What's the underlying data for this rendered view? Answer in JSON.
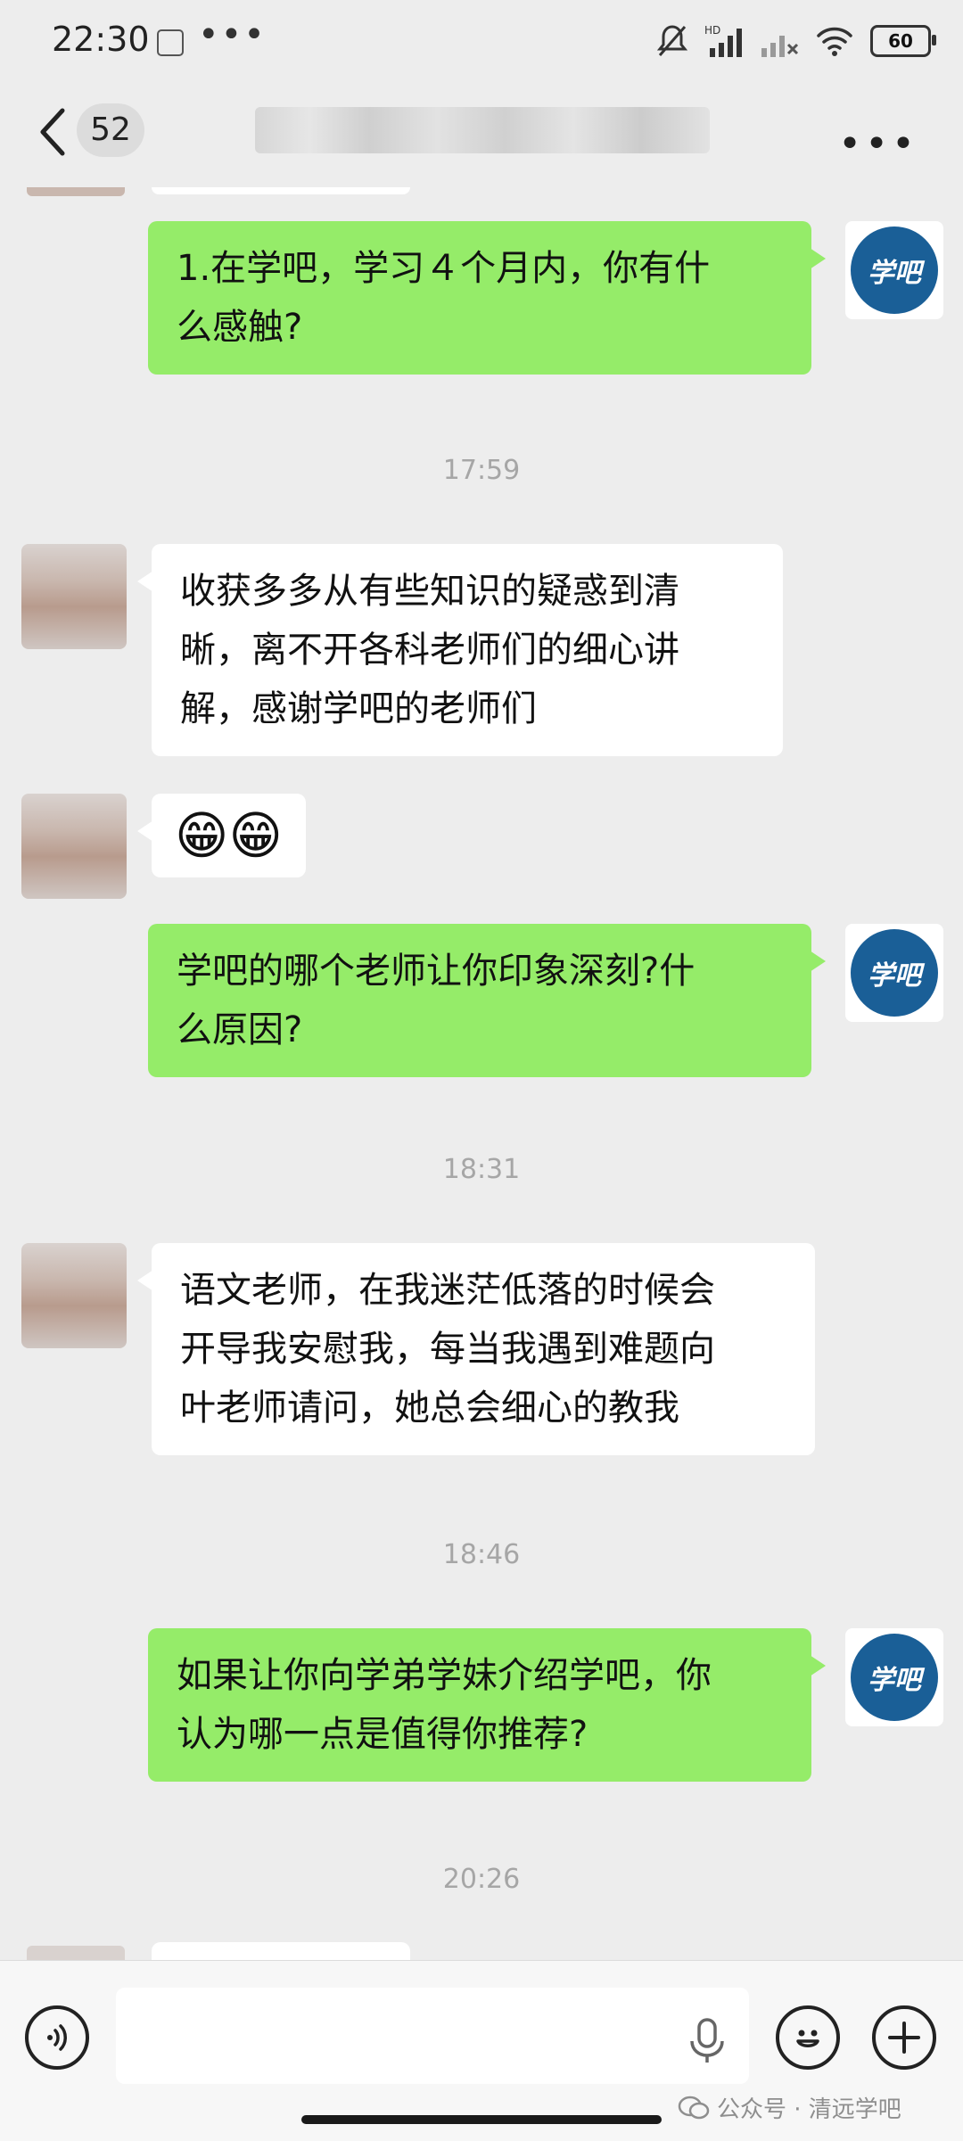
{
  "status_bar": {
    "time": "22:30",
    "dots": "•••",
    "hd": "HD",
    "battery": "60",
    "icons": [
      "notification-icon",
      "mute-icon",
      "signal-icon",
      "signal-x-icon",
      "wifi-icon",
      "battery-icon"
    ]
  },
  "nav": {
    "back_icon": "chevron-left-icon",
    "unread_count": "52",
    "title": "",
    "more_label": "•••"
  },
  "messages": [
    {
      "side": "me",
      "text": "1.在学吧，学习4个月内，你有什么感触?",
      "lines": [
        "1.在学吧，学习４个月内，你有什",
        "么感触?"
      ]
    },
    {
      "type": "time",
      "text": "17:59"
    },
    {
      "side": "other",
      "lines": [
        "收获多多从有些知识的疑惑到清",
        "晰，离不开各科老师们的细心讲",
        "解，感谢学吧的老师们"
      ]
    },
    {
      "side": "other",
      "emoji": "😁😁"
    },
    {
      "side": "me",
      "lines": [
        "学吧的哪个老师让你印象深刻?什",
        "么原因?"
      ]
    },
    {
      "type": "time",
      "text": "18:31"
    },
    {
      "side": "other",
      "lines": [
        "语文老师，在我迷茫低落的时候会",
        "开导我安慰我，每当我遇到难题向",
        "叶老师请问，她总会细心的教我"
      ]
    },
    {
      "type": "time",
      "text": "18:46"
    },
    {
      "side": "me",
      "lines": [
        "如果让你向学弟学妹介绍学吧，你",
        "认为哪一点是值得你推荐?"
      ]
    },
    {
      "type": "time",
      "text": "20:26"
    }
  ],
  "avatar_me_logo": "学吧",
  "input_bar": {
    "voice_icon": "voice-icon",
    "mic_icon": "mic-icon",
    "emoji_icon": "emoji-icon",
    "plus_icon": "plus-icon"
  },
  "watermark": "公众号 · 清远学吧"
}
